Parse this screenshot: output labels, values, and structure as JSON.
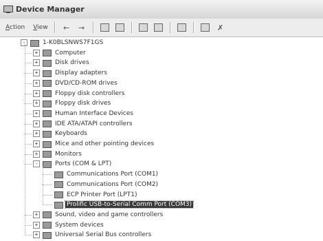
{
  "window": {
    "title": "Device Manager"
  },
  "toolbar": {
    "menus": [
      {
        "label": "Action",
        "accel": "A"
      },
      {
        "label": "View",
        "accel": "V"
      }
    ]
  },
  "tree": {
    "root": "1-K0BLSNWS7F1GS",
    "items": [
      {
        "label": "Computer",
        "icon": "computer-icon",
        "expander": "+"
      },
      {
        "label": "Disk drives",
        "icon": "disk-drive-icon",
        "expander": "+"
      },
      {
        "label": "Display adapters",
        "icon": "display-adapter-icon",
        "expander": "+"
      },
      {
        "label": "DVD/CD-ROM drives",
        "icon": "dvd-drive-icon",
        "expander": "+"
      },
      {
        "label": "Floppy disk controllers",
        "icon": "controller-icon",
        "expander": "+"
      },
      {
        "label": "Floppy disk drives",
        "icon": "floppy-drive-icon",
        "expander": "+"
      },
      {
        "label": "Human Interface Devices",
        "icon": "hid-icon",
        "expander": "+"
      },
      {
        "label": "IDE ATA/ATAPI controllers",
        "icon": "controller-icon",
        "expander": "+"
      },
      {
        "label": "Keyboards",
        "icon": "keyboard-icon",
        "expander": "+"
      },
      {
        "label": "Mice and other pointing devices",
        "icon": "mouse-icon",
        "expander": "+"
      },
      {
        "label": "Monitors",
        "icon": "monitor-icon",
        "expander": "+"
      },
      {
        "label": "Ports (COM & LPT)",
        "icon": "port-icon",
        "expander": "-"
      },
      {
        "label": "Sound, video and game controllers",
        "icon": "sound-icon",
        "expander": "+"
      },
      {
        "label": "System devices",
        "icon": "system-device-icon",
        "expander": "+"
      },
      {
        "label": "Universal Serial Bus controllers",
        "icon": "usb-icon",
        "expander": "+"
      }
    ],
    "ports": [
      {
        "label": "Communications Port (COM1)",
        "icon": "port-icon"
      },
      {
        "label": "Communications Port (COM2)",
        "icon": "port-icon"
      },
      {
        "label": "ECP Printer Port (LPT1)",
        "icon": "port-icon"
      },
      {
        "label": "Prolific USB-to-Serial Comm Port (COM3)",
        "icon": "port-icon",
        "selected": true
      }
    ]
  }
}
